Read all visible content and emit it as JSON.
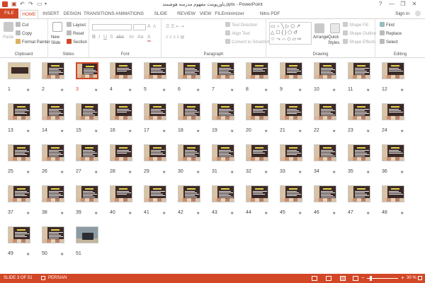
{
  "window": {
    "title": "پاورپوینت مفهوم مدرسه هوشمند.pptx - PowerPoint",
    "help": "?",
    "minimize": "—",
    "restore": "❐",
    "close": "✕"
  },
  "tabs": [
    "FILE",
    "HOME",
    "INSERT",
    "DESIGN",
    "TRANSITIONS",
    "ANIMATIONS",
    "SLIDE SHOW",
    "REVIEW",
    "VIEW",
    "FILEminimizer",
    "Nitro PDF Professional"
  ],
  "active_tab": "HOME",
  "signin": "Sign in",
  "ribbon": {
    "clipboard": {
      "label": "Clipboard",
      "paste": "Paste",
      "cut": "Cut",
      "copy": "Copy",
      "format_painter": "Format Painter"
    },
    "slides": {
      "label": "Slides",
      "new_slide": "New Slide",
      "layout": "Layout",
      "reset": "Reset",
      "section": "Section"
    },
    "font": {
      "label": "Font"
    },
    "paragraph": {
      "label": "Paragraph",
      "text_direction": "Text Direction",
      "align_text": "Align Text",
      "convert_smartart": "Convert to SmartArt"
    },
    "drawing": {
      "label": "Drawing",
      "arrange": "Arrange",
      "quick_styles": "Quick Styles",
      "shape_fill": "Shape Fill",
      "shape_outline": "Shape Outline",
      "shape_effects": "Shape Effects"
    },
    "editing": {
      "label": "Editing",
      "find": "Find",
      "replace": "Replace",
      "select": "Select"
    }
  },
  "slides": {
    "count": 51,
    "selected": 3,
    "photo_slide": 51,
    "cover_slide": 1,
    "star": "★"
  },
  "status": {
    "slide_info": "SLIDE 3 OF 51",
    "language": "PERSIAN",
    "zoom_minus": "−",
    "zoom_plus": "+",
    "zoom": "30 %"
  },
  "colors": {
    "accent": "#d24726",
    "slide_bg": "#3b2a28",
    "slide_title": "#e8d34a"
  }
}
